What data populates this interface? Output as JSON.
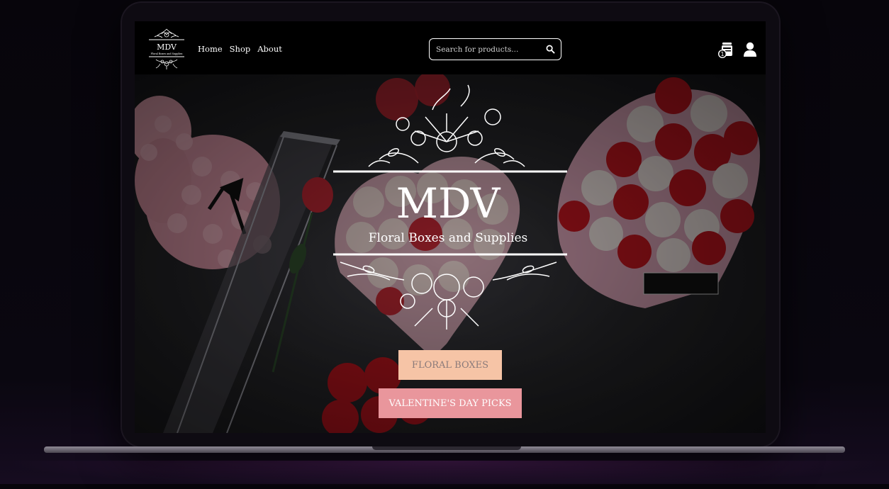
{
  "brand": {
    "logo_text": "MDV",
    "logo_subtext": "Floral Boxes and Supplies"
  },
  "nav": {
    "items": [
      "Home",
      "Shop",
      "About"
    ]
  },
  "search": {
    "placeholder": "Search for products..."
  },
  "cart": {
    "count": "1"
  },
  "icons": {
    "search": "search-icon",
    "cart": "shopping-bag-icon",
    "user": "user-icon"
  },
  "hero": {
    "title": "MDV",
    "subtitle": "Floral Boxes and Supplies",
    "primary_button": "FLORAL BOXES",
    "secondary_button": "VALENTINE'S DAY PICKS"
  },
  "colors": {
    "primary_button_bg": "#f6c4a6",
    "secondary_button_bg": "#e9969c",
    "navbar_bg": "#000000"
  }
}
